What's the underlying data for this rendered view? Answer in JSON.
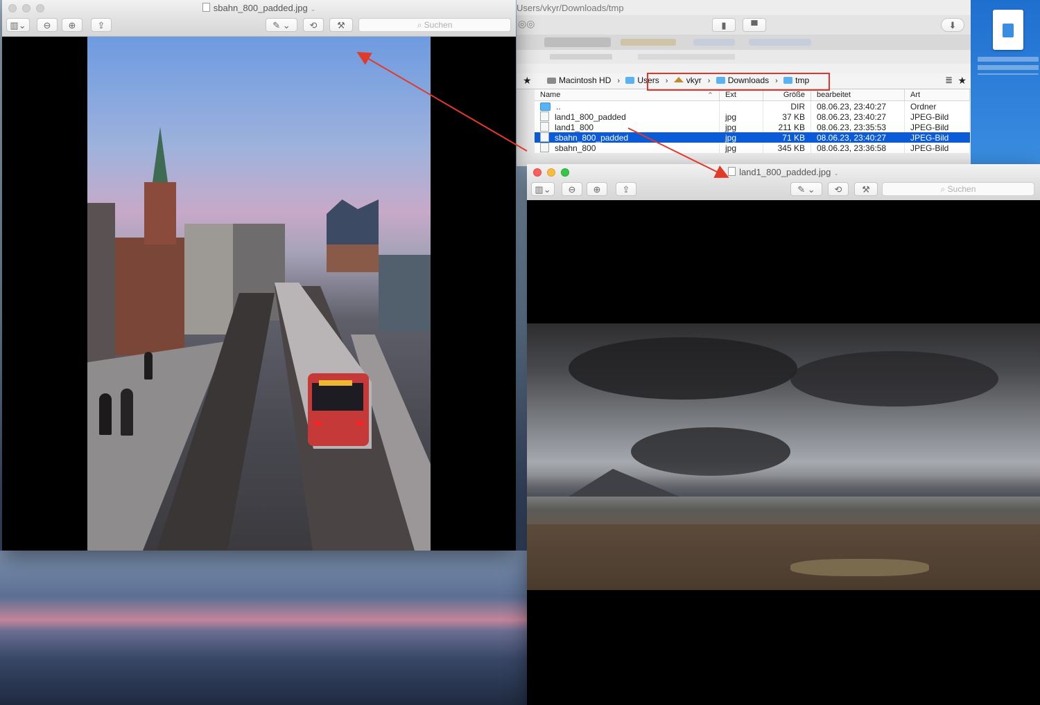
{
  "viewer1": {
    "title": "sbahn_800_padded.jpg",
    "search_placeholder": "Suchen",
    "chevron": "⌄"
  },
  "finder": {
    "path_title": "Users/vkyr/Downloads/tmp",
    "breadcrumb": [
      "Macintosh HD",
      "Users",
      "vkyr",
      "Downloads",
      "tmp"
    ],
    "columns": [
      "Name",
      "Ext",
      "Größe",
      "bearbeitet",
      "Art"
    ],
    "rows": [
      {
        "name": "..",
        "ext": "",
        "size": "DIR",
        "modified": "08.06.23, 23:40:27",
        "kind": "Ordner"
      },
      {
        "name": "land1_800_padded",
        "ext": "jpg",
        "size": "37 KB",
        "modified": "08.06.23, 23:40:27",
        "kind": "JPEG-Bild"
      },
      {
        "name": "land1_800",
        "ext": "jpg",
        "size": "211 KB",
        "modified": "08.06.23, 23:35:53",
        "kind": "JPEG-Bild"
      },
      {
        "name": "sbahn_800_padded",
        "ext": "jpg",
        "size": "71 KB",
        "modified": "08.06.23, 23:40:27",
        "kind": "JPEG-Bild"
      },
      {
        "name": "sbahn_800",
        "ext": "jpg",
        "size": "345 KB",
        "modified": "08.06.23, 23:36:58",
        "kind": "JPEG-Bild"
      }
    ],
    "selected_row": 3
  },
  "viewer2": {
    "title": "land1_800_padded.jpg",
    "search_placeholder": "Suchen"
  },
  "colors": {
    "highlight_red": "#e0362c",
    "selection_blue": "#0b5ad7",
    "arrow_red": "#e03a2a"
  },
  "icons": [
    "sidebar-icon",
    "zoom-out-icon",
    "zoom-in-icon",
    "share-icon",
    "markup-icon",
    "rotate-icon",
    "toolbox-icon",
    "search-icon",
    "star-icon",
    "folder-icon",
    "home-icon",
    "drive-icon",
    "document-icon"
  ]
}
